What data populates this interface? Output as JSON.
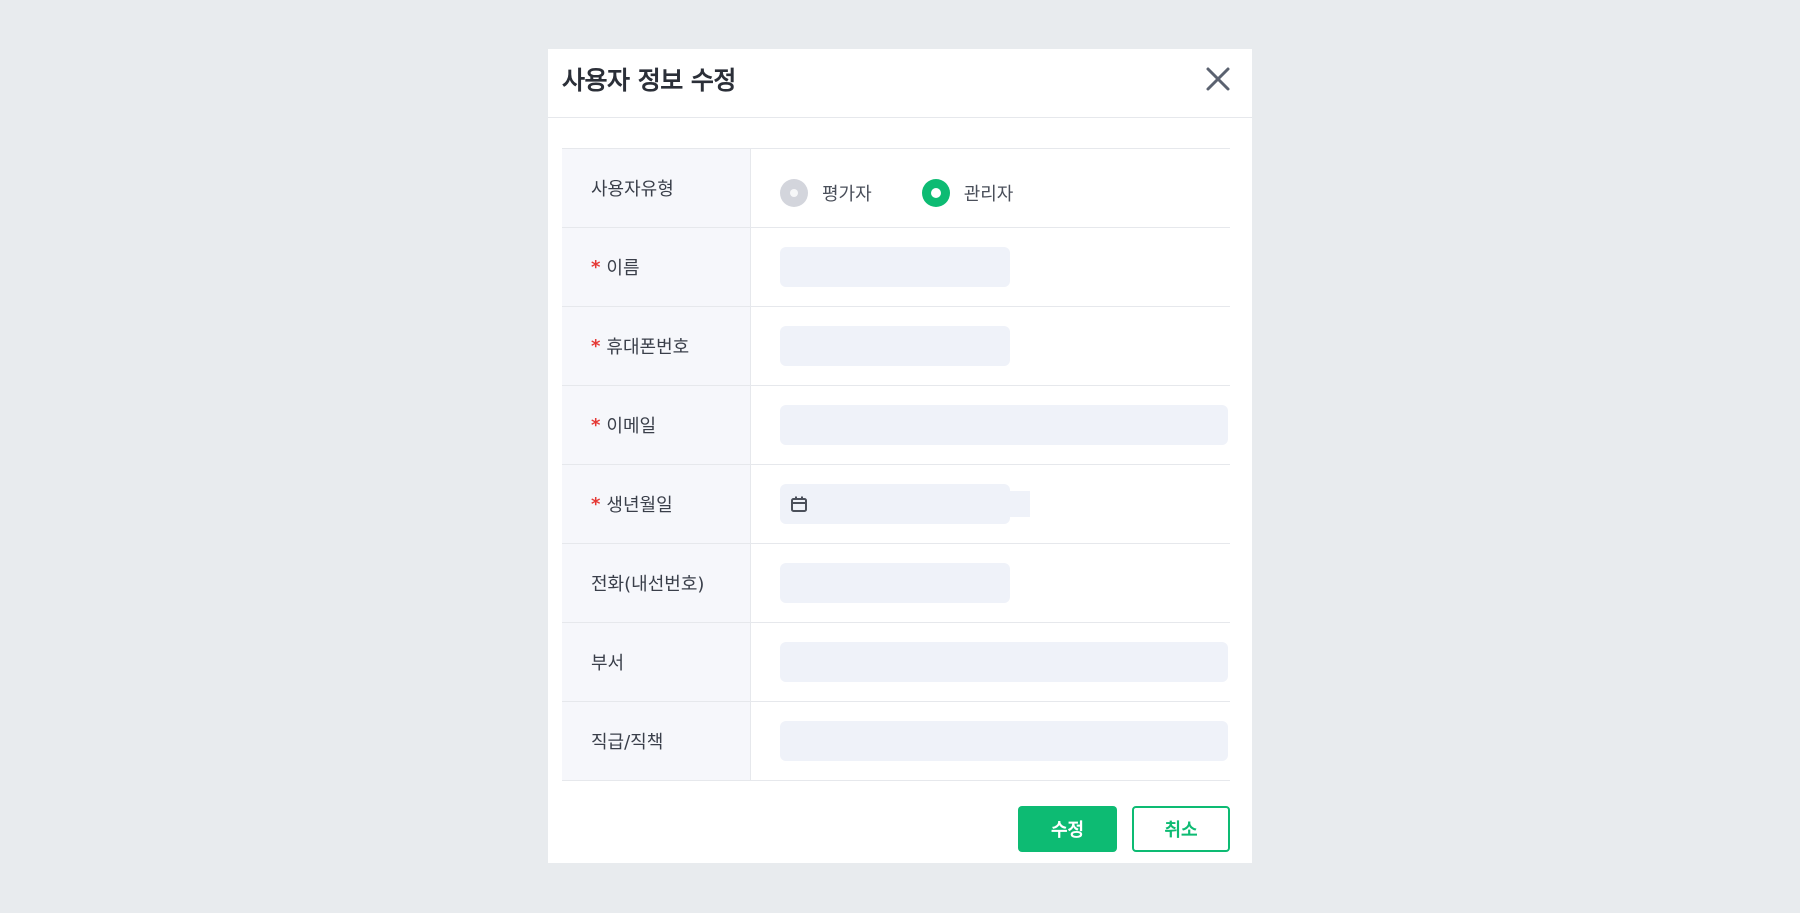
{
  "modal": {
    "title": "사용자 정보 수정"
  },
  "colors": {
    "accent": "#0dbb73",
    "required": "#e53935",
    "input_bg": "#eff2f9",
    "label_bg": "#f6f7fb"
  },
  "form": {
    "user_type": {
      "label": "사용자유형",
      "options": [
        {
          "label": "평가자",
          "selected": false
        },
        {
          "label": "관리자",
          "selected": true
        }
      ]
    },
    "name": {
      "label": "이름",
      "required_mark": "*",
      "value": ""
    },
    "mobile": {
      "label": "휴대폰번호",
      "required_mark": "*",
      "value": ""
    },
    "email": {
      "label": "이메일",
      "required_mark": "*",
      "value": ""
    },
    "birthdate": {
      "label": "생년월일",
      "required_mark": "*",
      "value": "",
      "icon": "calendar-icon"
    },
    "phone_ext": {
      "label": "전화(내선번호)",
      "value": ""
    },
    "department": {
      "label": "부서",
      "value": ""
    },
    "position": {
      "label": "직급/직책",
      "value": ""
    }
  },
  "buttons": {
    "submit_label": "수정",
    "cancel_label": "취소",
    "close_icon": "close-icon"
  }
}
